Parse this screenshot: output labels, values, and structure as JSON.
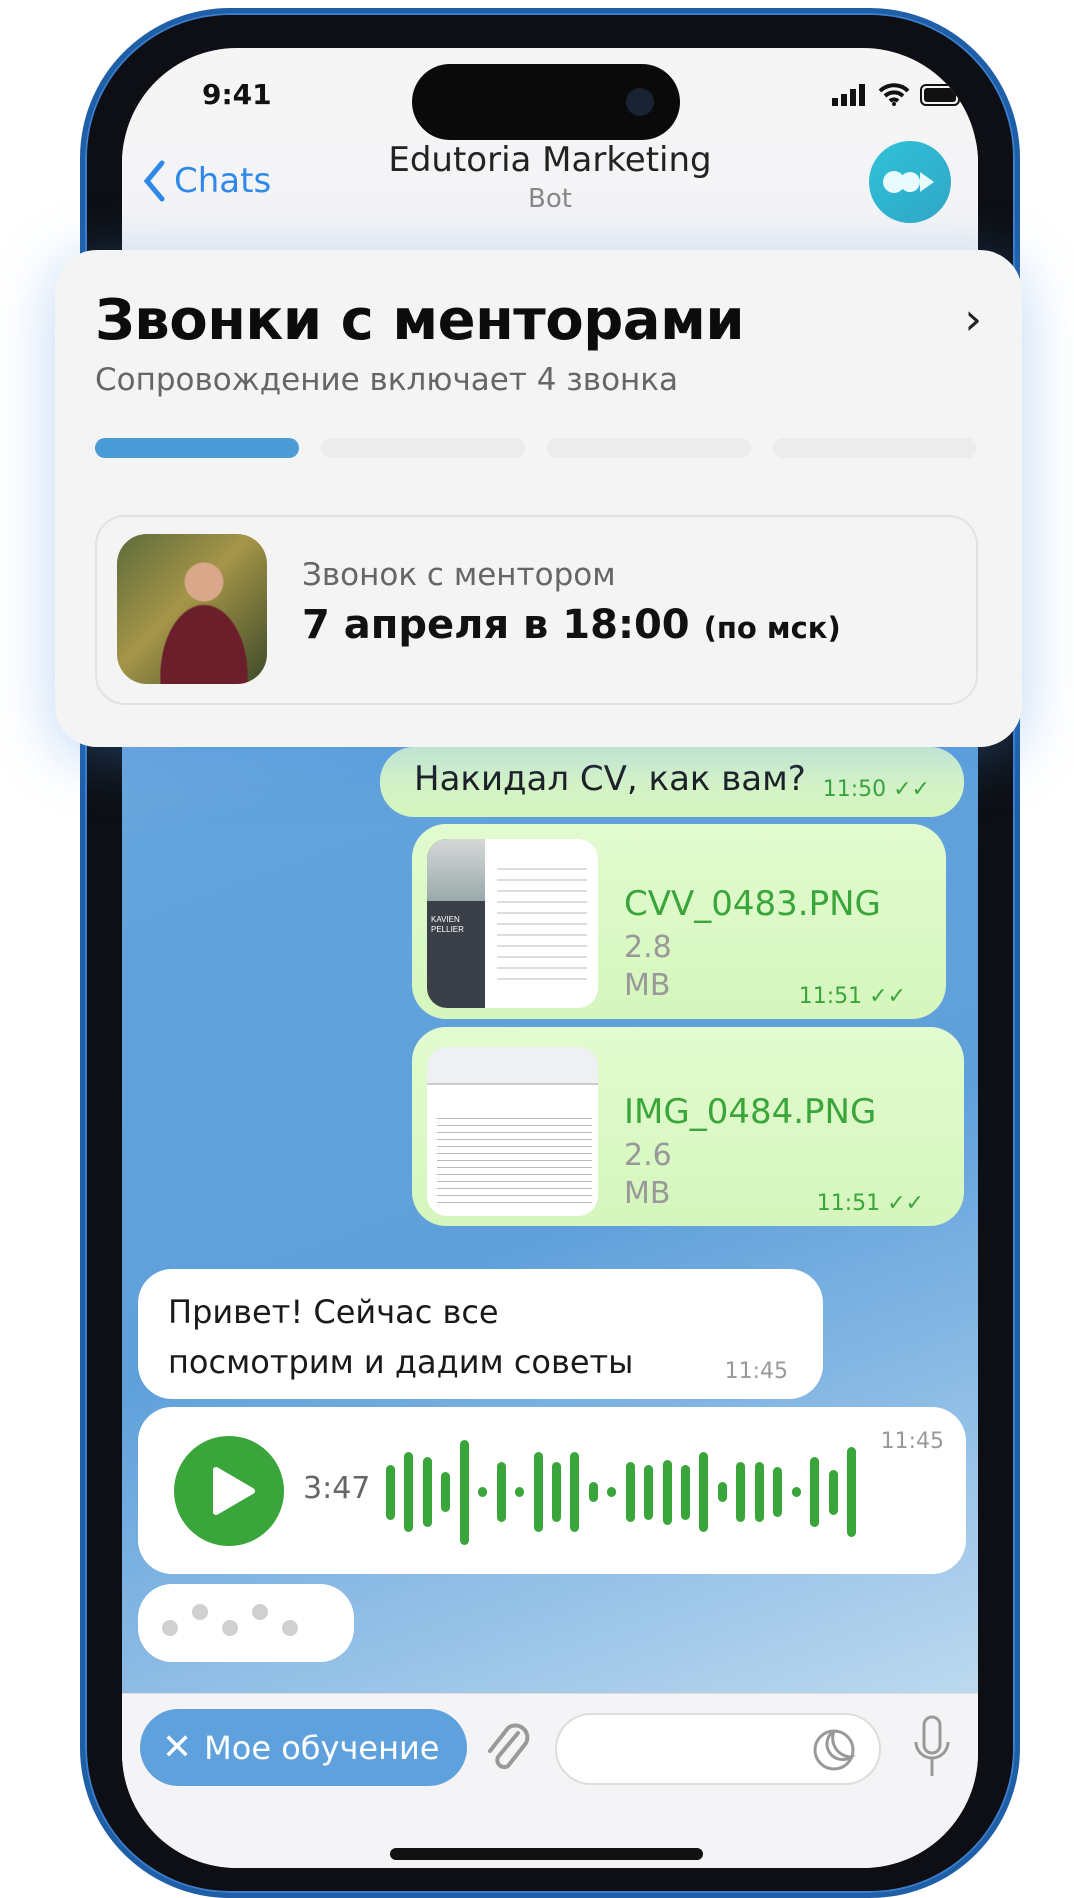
{
  "status_bar": {
    "time": "9:41"
  },
  "header": {
    "back_label": "Chats",
    "title": "Edutoria Marketing",
    "subtitle": "Bot"
  },
  "card": {
    "title": "Звонки с менторами",
    "subtitle": "Сопровождение включает 4 звонка",
    "progress": {
      "completed": 1,
      "total": 4
    },
    "accent": "#4a9bd6",
    "call": {
      "label": "Звонок с ментором",
      "date": "7 апреля в 18:00",
      "tz": "(по мск)"
    }
  },
  "messages": [
    {
      "text": "Накидал CV, как вам?",
      "time": "11:50"
    },
    {
      "file": "CVV_0483.PNG",
      "size_num": "2.8",
      "size_unit": "MB",
      "time": "11:51",
      "thumb_text": "KAVIEN PELLIER"
    },
    {
      "file": "IMG_0484.PNG",
      "size_num": "2.6",
      "size_unit": "MB",
      "time": "11:51"
    },
    {
      "text1": "Привет! Сейчас все",
      "text2": "посмотрим и дадим советы",
      "time": "11:45"
    },
    {
      "duration": "3:47",
      "time": "11:45"
    }
  ],
  "input": {
    "menu_label": "Мое обучение",
    "placeholder": ""
  },
  "colors": {
    "outgoing": "#dcf8c6",
    "accent_green": "#3aa53a",
    "link": "#2f89e8"
  }
}
